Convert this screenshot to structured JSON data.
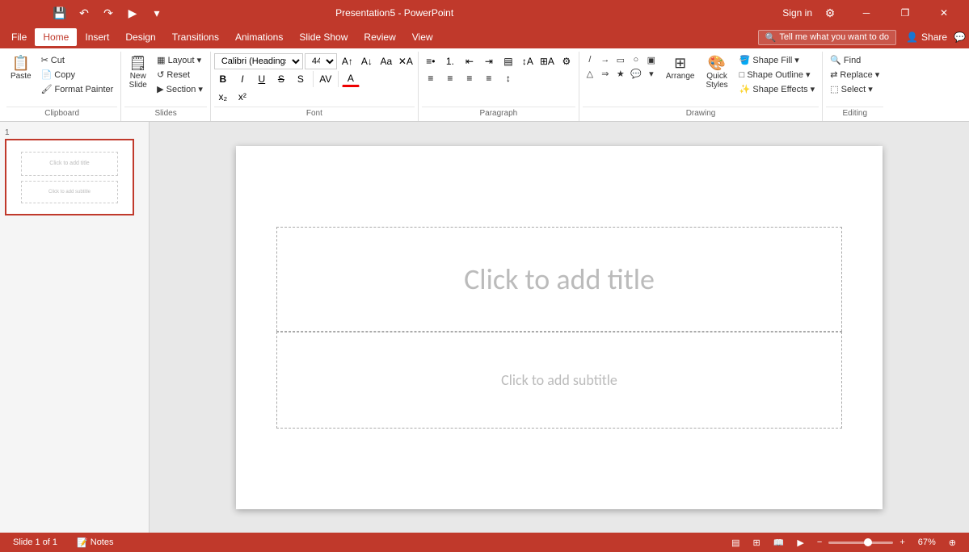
{
  "titlebar": {
    "title": "Presentation5 - PowerPoint",
    "sign_in": "Sign in",
    "win_min": "─",
    "win_restore": "❐",
    "win_close": "✕"
  },
  "menu": {
    "items": [
      "File",
      "Home",
      "Insert",
      "Design",
      "Transitions",
      "Animations",
      "Slide Show",
      "Review",
      "View"
    ],
    "active": "Home",
    "search_placeholder": "Tell me what you want to do",
    "share_label": "Share"
  },
  "ribbon": {
    "groups": {
      "clipboard": {
        "label": "Clipboard",
        "paste_label": "Paste"
      },
      "slides": {
        "label": "Slides",
        "new_slide": "New\nSlide",
        "layout": "Layout",
        "reset": "Reset",
        "section": "Section"
      },
      "font": {
        "label": "Font",
        "font_name": "Calibri (Headings)",
        "font_size": "44"
      },
      "paragraph": {
        "label": "Paragraph"
      },
      "drawing": {
        "label": "Drawing",
        "shape_fill": "Shape Fill",
        "shape_outline": "Shape Outline",
        "shape_effects": "Shape Effects",
        "arrange": "Arrange",
        "quick_styles": "Quick Styles"
      },
      "editing": {
        "label": "Editing",
        "find": "Find",
        "replace": "Replace",
        "select": "Select"
      }
    },
    "quick_access": {
      "save": "💾",
      "undo": "↶",
      "redo": "↷",
      "present": "▶",
      "more": "▾"
    }
  },
  "slide": {
    "number": "1",
    "title_placeholder": "Click to add title",
    "subtitle_placeholder": "Click to add subtitle"
  },
  "statusbar": {
    "slide_info": "Slide 1 of 1",
    "notes": "Notes",
    "zoom_value": "67%",
    "zoom_fit": "⊕"
  }
}
